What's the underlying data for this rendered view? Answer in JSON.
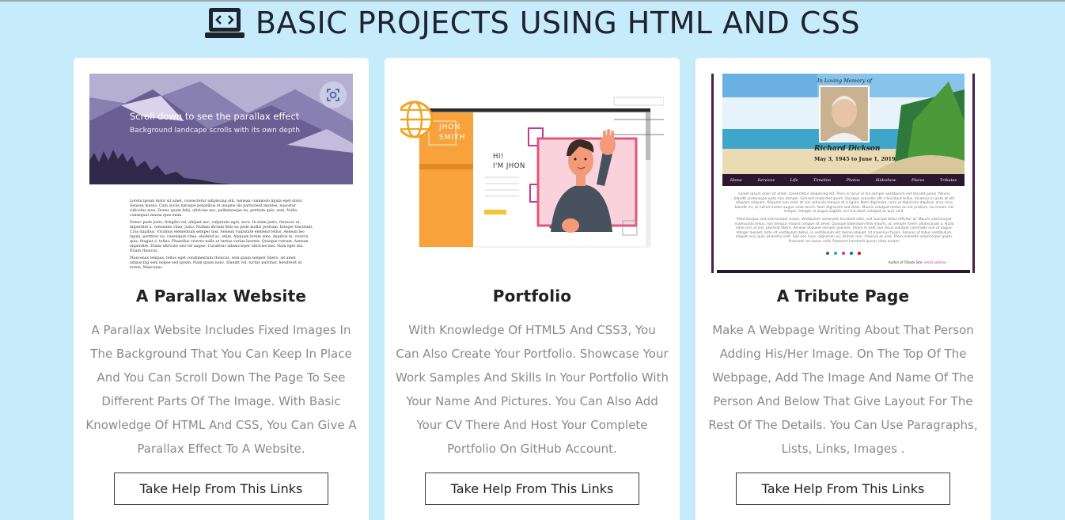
{
  "page": {
    "title": "BASIC PROJECTS USING HTML AND CSS",
    "title_icon": "laptop-code-icon",
    "colors": {
      "background": "#c6ecfb",
      "card": "#ffffff",
      "title": "#1f2330",
      "description": "#8a8a8a"
    }
  },
  "cards": [
    {
      "title": "A Parallax Website",
      "description": "A Parallax Website Includes Fixed Images In The Background That You Can Keep In Place And You Can Scroll Down The Page To See Different Parts Of The Image. With Basic Knowledge Of HTML And CSS, You Can Give A Parallax Effect To A Website.",
      "button_label": "Take Help From This Links",
      "thumbnail": {
        "hero_heading": "Scroll down to see the parallax effect",
        "hero_subheading": "Background landcape scrolls with its own depth",
        "scan_icon": "screenshot-scan-icon",
        "paragraphs": [
          "Lorem ipsum dolor sit amet, consectetur adipiscing elit. Aenean commodo ligula eget dolor. Aenean massa. Cum sociis natoque penatibus et magnis dis parturient montes, nascetur ridiculus mus. Donec quam felis, ultricies nec, pellentesque eu, pretium quis, sem. Nulla consequat massa quis enim.",
          "Donec pede justo, fringilla vel, aliquet nec, vulputate eget, arcu. In enim justo, rhoncus ut, imperdiet a, venenatis vitae, justo. Nullam dictum felis eu pede mollis pretium. Integer tincidunt. Cras dapibus. Vivamus elementum semper nisi. Aenean vulputate eleifend tellus. Aenean leo ligula, porttitor eu, consequat vitae, eleifend ac, enim. Aliquam lorem ante, dapibus in, viverra quis, feugiat a, tellus. Phasellus viverra nulla ut metus varius laoreet. Quisque rutrum. Aenean imperdiet. Etiam ultricies nisi vel augue. Curabitur ullamcorper ultricies nisi. Nam eget dui. Etiam rhoncus.",
          "Maecenas tempus, tellus eget condimentum rhoncus, sem quam semper libero, sit amet adipiscing sem neque sed ipsum. Nam quam nunc, blandit vel, luctus pulvinar, hendrerit id, lorem. Maecenas"
        ]
      }
    },
    {
      "title": "Portfolio",
      "description": "With Knowledge Of HTML5 And CSS3, You Can Also Create Your Portfolio. Showcase Your Work Samples And Skills In Your Portfolio With Your Name And Pictures. You Can Also Add Your CV There And Host Your Complete Portfolio On GitHub Account.",
      "button_label": "Take Help From This Links",
      "thumbnail": {
        "sidebar_name_line1": "JHON",
        "sidebar_name_line2": "SMITH",
        "greeting_line1": "HI!",
        "greeting_line2": "I'M JHON",
        "globe_icon": "globe-icon",
        "waving_person": "waving-person-illustration"
      }
    },
    {
      "title": "A Tribute Page",
      "description": "Make A Webpage Writing About That Person Adding His/Her Image. On The Top Of The Webpage, Add The Image And Name Of The Person And Below That Give Layout For The Rest Of The Details. You Can Use Paragraphs, Lists, Links, Images .",
      "button_label": "Take Help From This Links",
      "thumbnail": {
        "memory_caption": "In Loving Memory of",
        "person_name": "Richard Dickson",
        "dates": "May 3, 1945 to June 1, 2019",
        "nav": [
          "Home",
          "Services",
          "Life",
          "Timeline",
          "Photos",
          "Slideshow",
          "Places",
          "Tributes"
        ],
        "paragraphs": [
          "Lorem ipsum dolor sit amet, consectetur adipiscing elit. Proin in lacus id dui semper vestibulum sed blandit purus. Mauris blandit scelerisque justo non semper. Sed sed imperdiet quam. Quisque convallis elit a tincidunt tellus. Vivamus in justo at elit aliquam aliquam. Aliquam non enim at nisl vehicula tempus et a ligula. Nam dignissim, urna ut dignissim dapibus, arcu risus blandit mi, ut rutrum tortor augue vitae lorem. Nam dignissim sed dolor. Mauris volutpat metus eu est pretium, eu ornare nisi tempor. Integer ut augue sagittis orci tincidunt volutpat ac quis velit.",
          "Pellentesque sed ullamcorper turpis. Vestibulum venenatis tincidunt nibh, sed suscipit tellus efficitur at. Mauris ullamcorper malesuada tellus, non tempus mauris congue sit amet. Quisque bibendum felis mauris, ac semper lorem ullamcorper a. Nulla vitae orci ut nisl, placerat libero. Aenean posuere semper posuere. Etiam in velit non lacus volutpat commodo non ut augue. Integer laoreet, ante sit vestibulum tellus, in vestibulum elit lacinia aliquet. Ut maximus turpis. Aenean ut tellus vestibulum, aliquet arcu quis, pharetra velit. Sed nec nunc, dignissim eu, dictum non, rhoncus ac eros. Proin molestie ullamcorper quam. Praesent vel varius velit. Praesent hendrerit ipsum vitae ornare."
        ],
        "social_icons": [
          "facebook-icon",
          "twitter-icon",
          "instagram-icon",
          "linkedin-icon",
          "pinterest-icon"
        ],
        "author_label": "Author of Tribute Site:",
        "author_link": "email address"
      }
    }
  ]
}
